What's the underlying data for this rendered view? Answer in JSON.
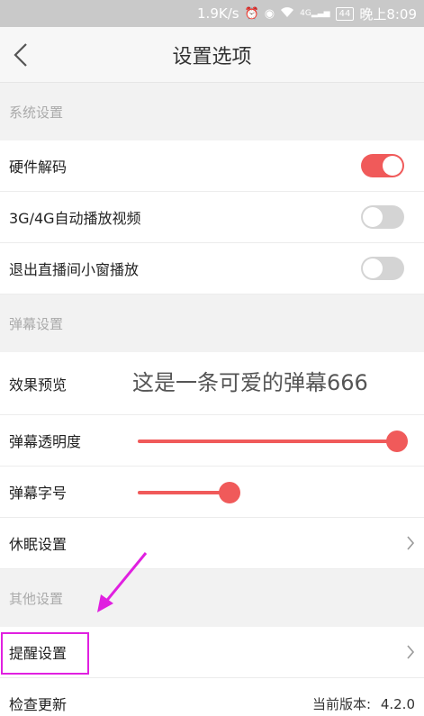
{
  "status_bar": {
    "speed": "1.9K/s",
    "network": "4G",
    "battery": "44",
    "time": "晚上8:09"
  },
  "header": {
    "title": "设置选项"
  },
  "sections": [
    {
      "title": "系统设置"
    },
    {
      "title": "弹幕设置"
    },
    {
      "title": "其他设置"
    }
  ],
  "system": {
    "hw_decode": {
      "label": "硬件解码",
      "enabled": true
    },
    "autoplay_3g4g": {
      "label": "3G/4G自动播放视频",
      "enabled": false
    },
    "exit_mini_window": {
      "label": "退出直播间小窗播放",
      "enabled": false
    }
  },
  "danmaku": {
    "preview": {
      "label": "效果预览",
      "text": "这是一条可爱的弹幕666"
    },
    "opacity": {
      "label": "弹幕透明度",
      "value_fraction": 1.0
    },
    "font_size": {
      "label": "弹幕字号",
      "value_fraction": 0.22
    },
    "sleep": {
      "label": "休眠设置"
    }
  },
  "other": {
    "reminder": {
      "label": "提醒设置"
    },
    "check_update": {
      "label": "检查更新",
      "version_label": "当前版本:",
      "version": "4.2.0"
    }
  },
  "colors": {
    "accent": "#f05a5a",
    "highlight": "#e020e0"
  }
}
